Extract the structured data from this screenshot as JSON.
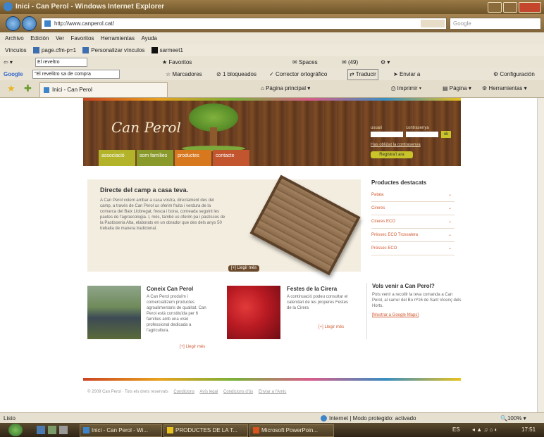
{
  "window": {
    "title": "Inici - Can Perol - Windows Internet Explorer"
  },
  "address": {
    "url": "http://www.canperol.cat/",
    "search_placeholder": "Google"
  },
  "menu": [
    "Archivo",
    "Edición",
    "Ver",
    "Favoritos",
    "Herramientas",
    "Ayuda"
  ],
  "links_bar": {
    "label": "Vínculos",
    "items": [
      "page.cfm-p=1",
      "Personalizar vínculos",
      "sarmeet1"
    ]
  },
  "toolbar3": {
    "input": "El reveltro",
    "favoritos": "Favoritos",
    "spaces": "Spaces",
    "count": "(49)"
  },
  "google_bar": {
    "label": "Google",
    "input": "\"El revelitro sa de compra",
    "items": [
      "Marcadores",
      "1 bloqueados",
      "Corrector ortográfico",
      "Traducir",
      "Enviar a",
      "Configuración"
    ]
  },
  "tabs": {
    "active": "Inici - Can Perol",
    "tools": [
      "Página principal",
      "Imprimir",
      "Página",
      "Herramientas"
    ]
  },
  "site": {
    "logo": "Can Perol",
    "nav_tabs": [
      {
        "label": "associació",
        "color": "#b3b32a"
      },
      {
        "label": "som famílies",
        "color": "#8a9a2a"
      },
      {
        "label": "productes",
        "color": "#d8781e"
      },
      {
        "label": "contacte",
        "color": "#c2542e"
      }
    ],
    "login": {
      "user_label": "usuari",
      "pass_label": "contrasenya",
      "ok": "ok",
      "forgot": "Has oblidat la contrasenya",
      "register": "Registra't ara"
    },
    "feature": {
      "title": "Directe del camp a casa teva.",
      "body": "A Can Perol volem arribar a casa vostra, directament des del camp, a través de Can Perol us oferim fruita i verdura de la comarca del Baix Llobregat, fresca i bona, conreada seguint les pautes de l'agroecologia. I, més, també us oferim pa i pastissos de la Pastisseria Alta, elaborats en un obrador que des dels anys 50 treballa de manera tradicional.",
      "more": "[+] Llegir més"
    },
    "products": {
      "title": "Productes destacats",
      "items": [
        "Patata",
        "Cireres",
        "Cireres ECO",
        "Préssec ECO Trossalera",
        "Préssec ECO"
      ]
    },
    "block1": {
      "title": "Coneix Can Perol",
      "body": "A Can Perol produïm i comercialitzem productes agroalimentaris de qualitat. Can Perol està constituïda per 6 famílies amb una visió professional dedicada a l'agricultura.",
      "more": "[+] Llegir més"
    },
    "block2": {
      "title": "Festes de la Cirera",
      "body": "A continuació podeu consultar el calendari de les properes Festes de la Cirera",
      "more": "[+] Llegir més"
    },
    "visit": {
      "title": "Vols venir a Can Perol?",
      "body": "Pots venir a recollir la teva comanda a Can Perol, al carrer del Bo nº16 de Sant Vicenç dels Horts.",
      "link": "[Mostrar a Google Maps]"
    },
    "footer": {
      "copyright": "© 2009 Can Perol · Tots els drets reservats",
      "links": [
        "Condicions",
        "Avís legal",
        "Condicions d'ús",
        "Enviar a l'Amic"
      ]
    }
  },
  "status": {
    "left": "Listo",
    "zone": "Internet | Modo protegido: activado",
    "zoom": "100%"
  },
  "taskbar": {
    "buttons": [
      "Inici - Can Perol - Wi...",
      "PRODUCTES DE LA T...",
      "Microsoft PowerPoin..."
    ],
    "tray": {
      "lang": "ES",
      "time": "17:51"
    }
  }
}
